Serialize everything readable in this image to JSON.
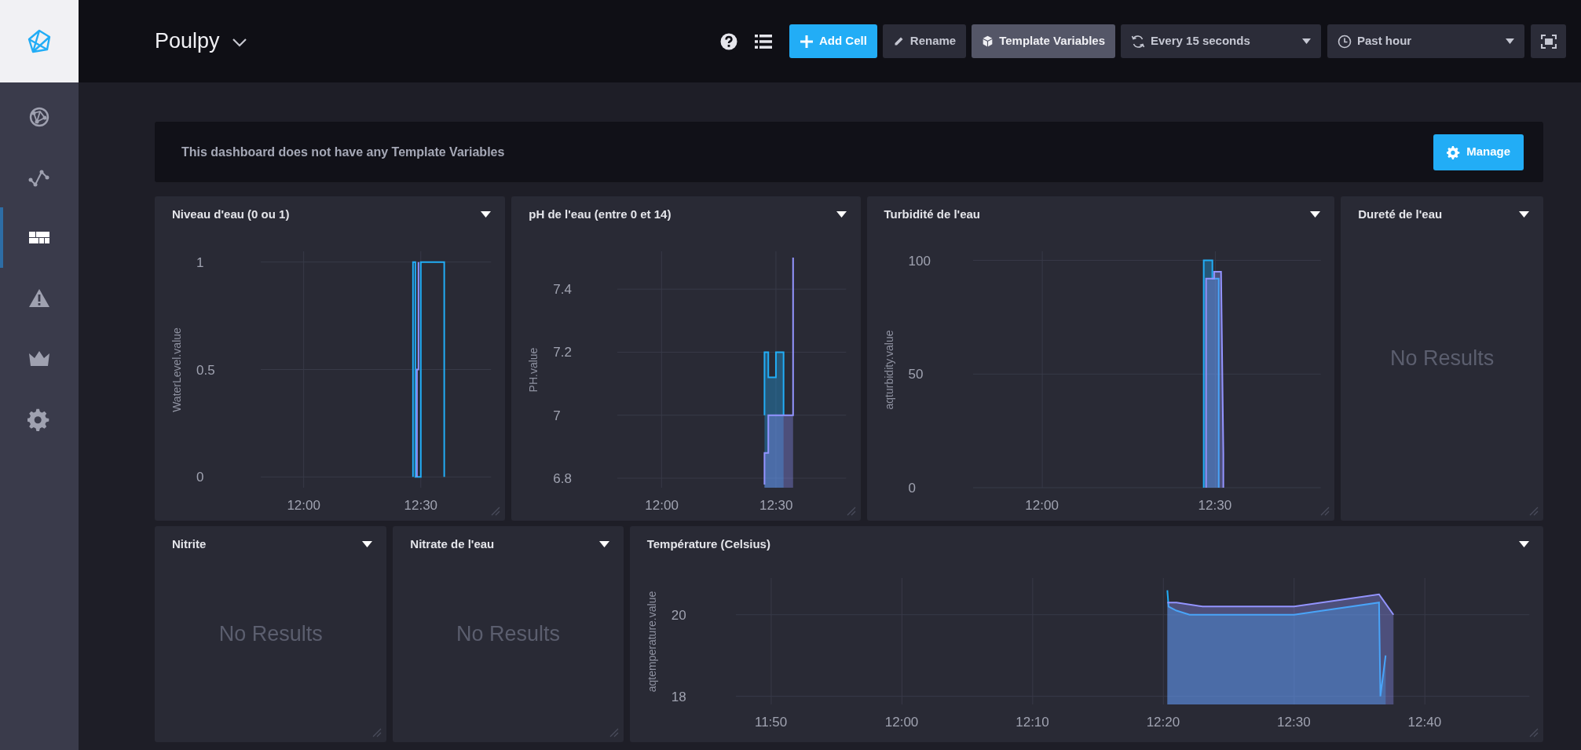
{
  "sidebar": {
    "items": [
      {
        "selected": false
      },
      {
        "selected": false
      },
      {
        "selected": true
      },
      {
        "selected": false
      },
      {
        "selected": false
      },
      {
        "selected": false
      }
    ]
  },
  "header": {
    "title": "Poulpy",
    "buttons": [
      {
        "label": "Add Cell",
        "kind": "primary",
        "active": false
      },
      {
        "label": "Rename",
        "kind": "default",
        "active": false
      },
      {
        "label": "Template Variables",
        "kind": "default",
        "active": true
      }
    ],
    "dropdowns": [
      {
        "label": "Every 15 seconds"
      },
      {
        "label": "Past hour"
      }
    ]
  },
  "template_bar": {
    "message": "This dashboard does not have any Template Variables",
    "button": "Manage"
  },
  "rows": [
    {
      "cells": [
        {
          "kind": "chart",
          "title": "Niveau d'eau (0 ou 1)",
          "chart_data": {
            "type": "line",
            "grid": true,
            "ylabel": "WaterLevel.value",
            "xlim": [
              709,
              768
            ],
            "ylim": [
              -0.05,
              1.05
            ],
            "yticks": [
              0,
              0.5,
              1
            ],
            "xticks": [
              {
                "value": 720,
                "label": "12:00"
              },
              {
                "value": 750,
                "label": "12:30"
              }
            ],
            "series": [
              {
                "color": "#22adf6",
                "x": [
                  748,
                  748,
                  748.6,
                  748.6,
                  750,
                  750,
                  756,
                  756
                ],
                "values": [
                  0,
                  1,
                  1,
                  0,
                  0,
                  1,
                  1,
                  0
                ]
              },
              {
                "color": "#9394ff",
                "x": [
                  749,
                  749,
                  749.4,
                  749.4
                ],
                "values": [
                  0,
                  0.5,
                  0.5,
                  1
                ]
              }
            ]
          }
        },
        {
          "kind": "chart",
          "title": "pH de l'eau (entre 0 et 14)",
          "chart_data": {
            "type": "area",
            "grid": true,
            "ylabel": "PH.value",
            "xlim": [
              708.4,
              768.4
            ],
            "ylim": [
              6.77,
              7.52
            ],
            "yticks": [
              6.8,
              7,
              7.2,
              7.4
            ],
            "xticks": [
              {
                "value": 720,
                "label": "12:00"
              },
              {
                "value": 750,
                "label": "12:30"
              }
            ],
            "series": [
              {
                "color": "#22adf6",
                "x": [
                  747,
                  747,
                  748,
                  748,
                  750,
                  750,
                  752,
                  752
                ],
                "values": [
                  7.0,
                  7.2,
                  7.2,
                  7.12,
                  7.12,
                  7.2,
                  7.2,
                  7.0
                ]
              },
              {
                "color": "#9394ff",
                "x": [
                  747,
                  747,
                  748,
                  748,
                  754.5,
                  754.5
                ],
                "values": [
                  6.78,
                  6.88,
                  6.88,
                  7.0,
                  7.0,
                  7.5
                ]
              }
            ]
          }
        },
        {
          "kind": "chart",
          "title": "Turbidité de l'eau",
          "chart_data": {
            "type": "area",
            "grid": true,
            "ylabel": "aqturbidity.value",
            "xlim": [
              708,
              768.3
            ],
            "ylim": [
              0,
              104
            ],
            "yticks": [
              0,
              50,
              100
            ],
            "xticks": [
              {
                "value": 720,
                "label": "12:00"
              },
              {
                "value": 750,
                "label": "12:30"
              }
            ],
            "series": [
              {
                "color": "#22adf6",
                "x": [
                  748,
                  748,
                  749.5,
                  749.5,
                  750.6,
                  750.6,
                  750.6
                ],
                "values": [
                  0,
                  100,
                  100,
                  92,
                  92,
                  50,
                  0
                ]
              },
              {
                "color": "#9394ff",
                "x": [
                  748.4,
                  748.4,
                  749.8,
                  749.8,
                  751,
                  751.4,
                  751.4
                ],
                "values": [
                  0,
                  92,
                  92,
                  95,
                  95,
                  15,
                  0
                ]
              }
            ]
          }
        },
        {
          "kind": "empty",
          "title": "Dureté de l'eau",
          "message": "No Results"
        }
      ]
    },
    {
      "cells": [
        {
          "kind": "empty",
          "title": "Nitrite",
          "message": "No Results"
        },
        {
          "kind": "empty",
          "title": "Nitrate de l'eau",
          "message": "No Results"
        },
        {
          "kind": "chart",
          "title": "Température (Celsius)",
          "chart_data": {
            "type": "area",
            "grid": true,
            "ylabel": "aqtemperature.value",
            "xlim": [
              707.3,
              768
            ],
            "ylim": [
              17.8,
              20.9
            ],
            "yticks": [
              18,
              20
            ],
            "xticks": [
              {
                "value": 710,
                "label": "11:50"
              },
              {
                "value": 720,
                "label": "12:00"
              },
              {
                "value": 730,
                "label": "12:10"
              },
              {
                "value": 740,
                "label": "12:20"
              },
              {
                "value": 750,
                "label": "12:30"
              },
              {
                "value": 760,
                "label": "12:40"
              }
            ],
            "series": [
              {
                "color": "#22adf6",
                "x": [
                  740.3,
                  740.4,
                  741,
                  742,
                  743,
                  750,
                  756.5,
                  756.6,
                  757
                ],
                "values": [
                  20.6,
                  20.2,
                  20.1,
                  20.0,
                  20.0,
                  20.0,
                  20.3,
                  18.0,
                  19.0
                ]
              },
              {
                "color": "#9394ff",
                "x": [
                  740.3,
                  741,
                  743,
                  750,
                  756.5,
                  757.6
                ],
                "values": [
                  20.3,
                  20.3,
                  20.2,
                  20.2,
                  20.5,
                  20.0
                ]
              }
            ]
          }
        }
      ]
    }
  ]
}
